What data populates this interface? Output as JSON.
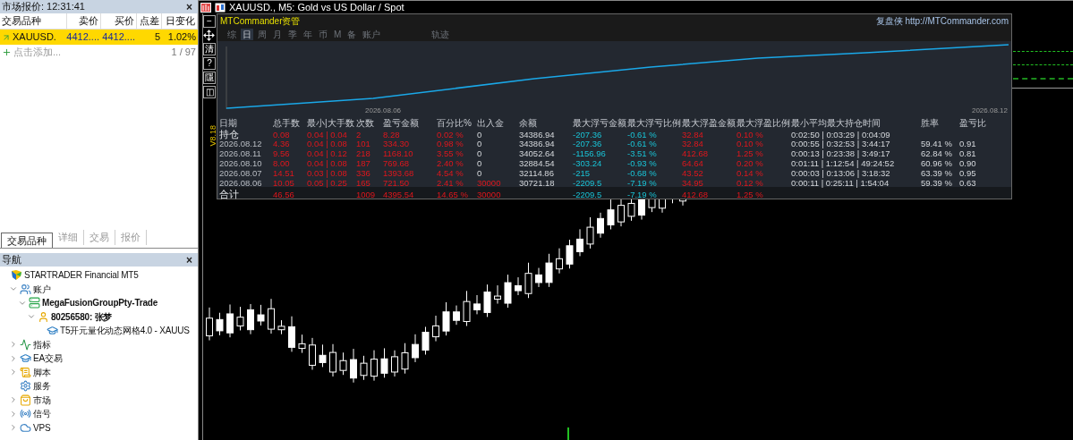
{
  "market_watch": {
    "title": "市场报价: 12:31:41",
    "close": "×",
    "columns": [
      "交易品种",
      "卖价",
      "买价",
      "点差",
      "日变化"
    ],
    "rows": [
      {
        "cells": [
          "XAUUSD.",
          "4412....",
          "4412....",
          "5",
          "1.02%"
        ],
        "selected": true
      }
    ],
    "add_label": "点击添加...",
    "count": "1 / 97",
    "tabs": [
      {
        "label": "交易品种",
        "selected": true
      },
      {
        "label": "详细",
        "selected": false
      },
      {
        "label": "交易",
        "selected": false
      },
      {
        "label": "报价",
        "selected": false
      }
    ]
  },
  "navigator": {
    "title": "导航",
    "close": "×",
    "tree": [
      {
        "label": "STARTRADER Financial MT5",
        "kind": "broker",
        "bold": false,
        "children": [
          {
            "label": "账户",
            "kind": "accounts",
            "bold": false,
            "expanded": true,
            "children": [
              {
                "label": "MegaFusionGroupPty-Trade",
                "kind": "server",
                "bold": true,
                "expanded": true,
                "children": [
                  {
                    "label": "80256580: 张梦",
                    "kind": "user",
                    "bold": true,
                    "expanded": true,
                    "children": [
                      {
                        "label": "T5开元量化动态网格4.0 - XAUUS",
                        "kind": "expert",
                        "bold": false
                      }
                    ]
                  }
                ]
              }
            ]
          },
          {
            "label": "指标",
            "kind": "indicator",
            "bold": false,
            "expanded": false
          },
          {
            "label": "EA交易",
            "kind": "expert",
            "bold": false,
            "expanded": false
          },
          {
            "label": "脚本",
            "kind": "script",
            "bold": false,
            "expanded": false
          },
          {
            "label": "服务",
            "kind": "service",
            "bold": false
          },
          {
            "label": "市场",
            "kind": "market",
            "bold": false,
            "expanded": false
          },
          {
            "label": "信号",
            "kind": "signal",
            "bold": false,
            "expanded": false
          },
          {
            "label": "VPS",
            "kind": "vps",
            "bold": false,
            "expanded": false
          }
        ]
      }
    ]
  },
  "chart": {
    "title": "XAUUSD., M5:  Gold vs US Dollar / Spot"
  },
  "chart_toolbar": [
    "−",
    "清",
    "?",
    "隱",
    "◫"
  ],
  "panel": {
    "brand": "MTCommander资管",
    "link": "复盘侠 http://MTCommander.com",
    "version": "V8.18",
    "tabs": [
      {
        "label": "综",
        "selected": false
      },
      {
        "label": "日",
        "selected": true
      },
      {
        "label": "周",
        "selected": false
      },
      {
        "label": "月",
        "selected": false
      },
      {
        "label": "季",
        "selected": false
      },
      {
        "label": "年",
        "selected": false
      },
      {
        "label": "币",
        "selected": false
      },
      {
        "label": "M",
        "selected": false
      },
      {
        "label": "备",
        "selected": false
      },
      {
        "label": "账户",
        "selected": false
      },
      {
        "label": "轨迹",
        "selected": false
      }
    ],
    "curve_start": "2026.08.06",
    "curve_end": "2026.08.12",
    "columns": [
      {
        "label": "日期",
        "kind": "date"
      },
      {
        "label": "总手数",
        "kind": "red"
      },
      {
        "label": "最小|大手数",
        "kind": "red"
      },
      {
        "label": "次数",
        "kind": "red"
      },
      {
        "label": "盈亏金额",
        "kind": "red"
      },
      {
        "label": "百分比%",
        "kind": "red"
      },
      {
        "label": "出入金",
        "kind": "flow"
      },
      {
        "label": "余额",
        "kind": "plain"
      },
      {
        "label": "最大浮亏金额",
        "kind": "cyan"
      },
      {
        "label": "最大浮亏比例",
        "kind": "cyan"
      },
      {
        "label": "最大浮盈金额",
        "kind": "red"
      },
      {
        "label": "最大浮盈比例",
        "kind": "red"
      },
      {
        "label": "最小平均最大持仓时间",
        "kind": "plain"
      },
      {
        "label": "胜率",
        "kind": "plain"
      },
      {
        "label": "盈亏比",
        "kind": "plain"
      }
    ],
    "rows": [
      {
        "kind": "open",
        "deposit": false,
        "cells": [
          "持仓",
          "0.08",
          "0.04 | 0.04",
          "2",
          "8.28",
          "0.02 %",
          "0",
          "34386.94",
          "-207.36",
          "-0.61 %",
          "32.84",
          "0.10 %",
          "0:02:50 | 0:03:29 | 0:04:09",
          "",
          ""
        ]
      },
      {
        "kind": "day",
        "deposit": false,
        "cells": [
          "2026.08.12",
          "4.36",
          "0.04 | 0.08",
          "101",
          "334.30",
          "0.98 %",
          "0",
          "34386.94",
          "-207.36",
          "-0.61 %",
          "32.84",
          "0.10 %",
          "0:00:55 | 0:32:53 | 3:44:17",
          "59.41 %",
          "0.91"
        ]
      },
      {
        "kind": "day",
        "deposit": false,
        "cells": [
          "2026.08.11",
          "9.56",
          "0.04 | 0.12",
          "218",
          "1168.10",
          "3.55 %",
          "0",
          "34052.64",
          "-1156.96",
          "-3.51 %",
          "412.68",
          "1.25 %",
          "0:00:13 | 0:23:38 | 3:49:17",
          "62.84 %",
          "0.81"
        ]
      },
      {
        "kind": "day",
        "deposit": false,
        "cells": [
          "2026.08.10",
          "8.00",
          "0.04 | 0.08",
          "187",
          "769.68",
          "2.40 %",
          "0",
          "32884.54",
          "-303.24",
          "-0.93 %",
          "64.64",
          "0.20 %",
          "0:01:11 | 1:12:54 | 49:24:52",
          "60.96 %",
          "0.90"
        ]
      },
      {
        "kind": "day",
        "deposit": false,
        "cells": [
          "2026.08.07",
          "14.51",
          "0.03 | 0.08",
          "336",
          "1393.68",
          "4.54 %",
          "0",
          "32114.86",
          "-215",
          "-0.68 %",
          "43.52",
          "0.14 %",
          "0:00:03 | 0:13:06 | 3:18:32",
          "63.39 %",
          "0.95"
        ]
      },
      {
        "kind": "day",
        "deposit": true,
        "cells": [
          "2026.08.06",
          "10.05",
          "0.05 | 0.25",
          "165",
          "721.50",
          "2.41 %",
          "30000",
          "30721.18",
          "-2209.5",
          "-7.19 %",
          "34.95",
          "0.12 %",
          "0:00:11 | 0:25:11 | 1:54:04",
          "59.39 %",
          "0.63"
        ]
      },
      {
        "kind": "total",
        "deposit": true,
        "cells": [
          "合计",
          "46.56",
          "",
          "1009",
          "4395.54",
          "14.65 %",
          "30000",
          "",
          "-2209.5",
          "-7.19 %",
          "412.68",
          "1.25 %",
          "",
          "",
          ""
        ]
      }
    ]
  }
}
